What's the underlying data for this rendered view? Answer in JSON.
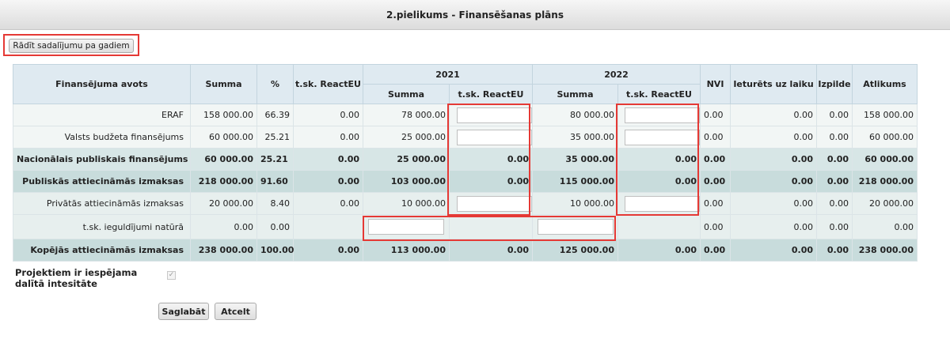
{
  "title": "2.pielikums - Finansēšanas plāns",
  "toggle_button": "Rādīt sadalījumu pa gadiem",
  "headers": {
    "source": "Finansējuma avots",
    "summa": "Summa",
    "pct": "%",
    "react": "t.sk. ReactEU",
    "year1": "2021",
    "year2": "2022",
    "y1_summa": "Summa",
    "y1_react": "t.sk. ReactEU",
    "y2_summa": "Summa",
    "y2_react": "t.sk. ReactEU",
    "nvi": "NVI",
    "ieturets": "Ieturēts uz laiku",
    "izpilde": "Izpilde",
    "atlikums": "Atlikums"
  },
  "rows": [
    {
      "label": "ERAF",
      "summa": "158 000.00",
      "pct": "66.39",
      "react": "0.00",
      "y1_summa": "78 000.00",
      "y1_react": "",
      "y2_summa": "80 000.00",
      "y2_react": "",
      "nvi": "0.00",
      "ieturets": "0.00",
      "izpilde": "0.00",
      "atlikums": "158 000.00"
    },
    {
      "label": "Valsts budžeta finansējums",
      "summa": "60 000.00",
      "pct": "25.21",
      "react": "0.00",
      "y1_summa": "25 000.00",
      "y1_react": "",
      "y2_summa": "35 000.00",
      "y2_react": "",
      "nvi": "0.00",
      "ieturets": "0.00",
      "izpilde": "0.00",
      "atlikums": "60 000.00"
    },
    {
      "label": "Nacionālais publiskais finansējums",
      "summa": "60 000.00",
      "pct": "25.21",
      "react": "0.00",
      "y1_summa": "25 000.00",
      "y1_react": "0.00",
      "y2_summa": "35 000.00",
      "y2_react": "0.00",
      "nvi": "0.00",
      "ieturets": "0.00",
      "izpilde": "0.00",
      "atlikums": "60 000.00"
    },
    {
      "label": "Publiskās attiecināmās izmaksas",
      "summa": "218 000.00",
      "pct": "91.60",
      "react": "0.00",
      "y1_summa": "103 000.00",
      "y1_react": "0.00",
      "y2_summa": "115 000.00",
      "y2_react": "0.00",
      "nvi": "0.00",
      "ieturets": "0.00",
      "izpilde": "0.00",
      "atlikums": "218 000.00"
    },
    {
      "label": "Privātās attiecināmās izmaksas",
      "summa": "20 000.00",
      "pct": "8.40",
      "react": "0.00",
      "y1_summa": "10 000.00",
      "y1_react": "",
      "y2_summa": "10 000.00",
      "y2_react": "",
      "nvi": "0.00",
      "ieturets": "0.00",
      "izpilde": "0.00",
      "atlikums": "20 000.00"
    },
    {
      "label": "t.sk. ieguldījumi natūrā",
      "summa": "0.00",
      "pct": "0.00",
      "react": "",
      "y1_summa": "",
      "y1_react": "",
      "y2_summa": "",
      "y2_react": "",
      "nvi": "0.00",
      "ieturets": "0.00",
      "izpilde": "0.00",
      "atlikums": "0.00"
    },
    {
      "label": "Kopējās attiecināmās izmaksas",
      "summa": "238 000.00",
      "pct": "100.00",
      "react": "0.00",
      "y1_summa": "113 000.00",
      "y1_react": "0.00",
      "y2_summa": "125 000.00",
      "y2_react": "0.00",
      "nvi": "0.00",
      "ieturets": "0.00",
      "izpilde": "0.00",
      "atlikums": "238 000.00"
    }
  ],
  "checkbox_label": "Projektiem ir iespējama dalītā intesitāte",
  "checkbox_checked": true,
  "save_button": "Saglabāt",
  "cancel_button": "Atcelt",
  "highlight_color": "#e53935"
}
